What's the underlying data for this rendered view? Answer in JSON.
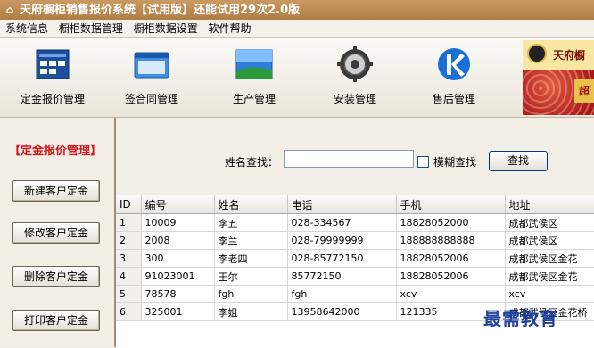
{
  "window": {
    "title": "天府橱柜销售报价系统【试用版】还能试用29次2.0版",
    "icon": "house-icon"
  },
  "menu": [
    "系统信息",
    "橱柜数据管理",
    "橱柜数据设置",
    "软件帮助"
  ],
  "toolbar": [
    {
      "label": "定金报价管理",
      "icon": "report-icon"
    },
    {
      "label": "签合同管理",
      "icon": "window-icon"
    },
    {
      "label": "生产管理",
      "icon": "landscape-icon"
    },
    {
      "label": "安装管理",
      "icon": "gear-icon"
    },
    {
      "label": "售后管理",
      "icon": "k-logo-icon"
    }
  ],
  "banner": {
    "text": "天府橱",
    "tag": "超"
  },
  "sidebar": {
    "title": "【定金报价管理】",
    "buttons": [
      "新建客户定金",
      "修改客户定金",
      "删除客户定金",
      "打印客户定金"
    ]
  },
  "search": {
    "label": "姓名查找：",
    "value": "",
    "fuzzy_label": "模糊查找",
    "fuzzy_checked": false,
    "button": "查找"
  },
  "table": {
    "columns": [
      "ID",
      "编号",
      "姓名",
      "电话",
      "手机",
      "地址"
    ],
    "rows": [
      [
        "1",
        "10009",
        "李五",
        "028-334567",
        "18828052000",
        "成都武侯区"
      ],
      [
        "2",
        "2008",
        "李兰",
        "028-79999999",
        "188888888888",
        "成都武侯区"
      ],
      [
        "3",
        "300",
        "李老四",
        "028-85772150",
        "18828052006",
        "成都武侯区金花"
      ],
      [
        "4",
        "91023001",
        "王尔",
        "85772150",
        "18828052006",
        "成都武侯区金花"
      ],
      [
        "5",
        "78578",
        "fgh",
        "fgh",
        "xcv",
        "xcv"
      ],
      [
        "6",
        "325001",
        "李姐",
        "13958642000",
        "121335",
        "成都武侯区金花桥"
      ]
    ]
  },
  "watermark": "最需教育"
}
